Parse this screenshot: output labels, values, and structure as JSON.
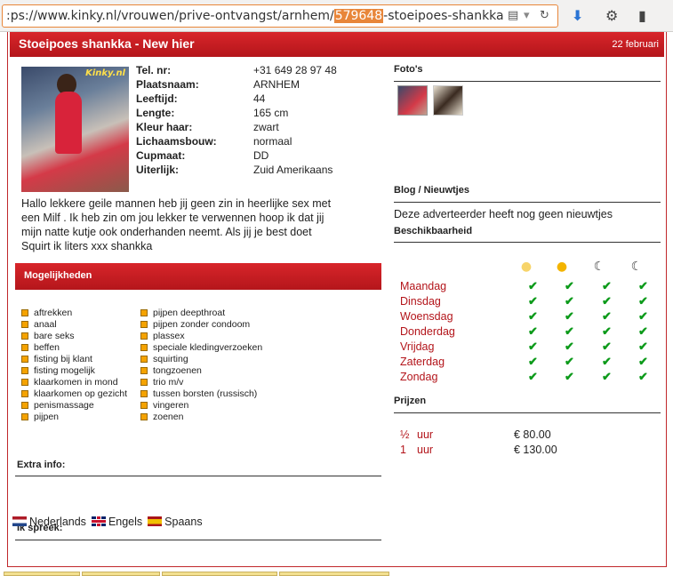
{
  "browser": {
    "url_prefix": ":ps://www.kinky.nl/vrouwen/prive-ontvangst/arnhem/",
    "url_highlight": "579648",
    "url_suffix": "-stoeipoes-shankka",
    "reader_icon": "reader-icon",
    "reload_icon": "reload-icon",
    "download_icon": "download-arrow-icon",
    "extension_icon": "extension-icon",
    "menu_icon": "menu-icon"
  },
  "header": {
    "title": "Stoeipoes shankka - New hier",
    "date": "22 februari"
  },
  "photo": {
    "logo": "Kinky.nl"
  },
  "info": [
    {
      "label": "Tel. nr:",
      "value": "+31 649 28 97 48"
    },
    {
      "label": "Plaatsnaam:",
      "value": "ARNHEM"
    },
    {
      "label": "Leeftijd:",
      "value": "44"
    },
    {
      "label": "Lengte:",
      "value": "165 cm"
    },
    {
      "label": "Kleur haar:",
      "value": "zwart"
    },
    {
      "label": "Lichaamsbouw:",
      "value": "normaal"
    },
    {
      "label": "Cupmaat:",
      "value": "DD"
    },
    {
      "label": "Uiterlijk:",
      "value": "Zuid Amerikaans"
    }
  ],
  "description": "Hallo lekkere geile mannen heb jij geen zin in heerlijke sex met een Milf . Ik heb zin om jou lekker te verwennen hoop ik dat jij mijn natte kutje ook onderhanden neemt. Als jij je best doet Squirt ik liters xxx shankka",
  "mogelijkheden": {
    "heading": "Mogelijkheden",
    "col1": [
      "aftrekken",
      "anaal",
      "bare seks",
      "beffen",
      "fisting bij klant",
      "fisting mogelijk",
      "klaarkomen in mond",
      "klaarkomen op gezicht",
      "penismassage",
      "pijpen"
    ],
    "col2": [
      "pijpen deepthroat",
      "pijpen zonder condoom",
      "plassex",
      "speciale kledingverzoeken",
      "squirting",
      "tongzoenen",
      "trio m/v",
      "tussen borsten (russisch)",
      "vingeren",
      "zoenen"
    ]
  },
  "extra_info": {
    "heading": "Extra info:"
  },
  "languages": {
    "heading": "Ik spreek:",
    "items": [
      {
        "label": "Nederlands",
        "flag": "flag-nl-icon"
      },
      {
        "label": "Engels",
        "flag": "flag-gb-icon"
      },
      {
        "label": "Spaans",
        "flag": "flag-es-icon"
      }
    ]
  },
  "photos": {
    "heading": "Foto's"
  },
  "blog": {
    "heading": "Blog / Nieuwtjes",
    "text": "Deze adverteerder heeft nog geen nieuwtjes"
  },
  "availability": {
    "heading": "Beschikbaarheid",
    "slots": [
      "sun-morning-icon",
      "sun-afternoon-icon",
      "moon-evening-icon",
      "moon-night-icon"
    ],
    "days": [
      {
        "day": "Maandag",
        "available": [
          true,
          true,
          true,
          true
        ]
      },
      {
        "day": "Dinsdag",
        "available": [
          true,
          true,
          true,
          true
        ]
      },
      {
        "day": "Woensdag",
        "available": [
          true,
          true,
          true,
          true
        ]
      },
      {
        "day": "Donderdag",
        "available": [
          true,
          true,
          true,
          true
        ]
      },
      {
        "day": "Vrijdag",
        "available": [
          true,
          true,
          true,
          true
        ]
      },
      {
        "day": "Zaterdag",
        "available": [
          true,
          true,
          true,
          true
        ]
      },
      {
        "day": "Zondag",
        "available": [
          true,
          true,
          true,
          true
        ]
      }
    ]
  },
  "prices": {
    "heading": "Prijzen",
    "rows": [
      {
        "qty": "½",
        "unit": "uur",
        "price": "€ 80.00"
      },
      {
        "qty": "1",
        "unit": "uur",
        "price": "€ 130.00"
      }
    ]
  },
  "colors": {
    "brand_red": "#c0282b",
    "day_red": "#b3141a",
    "check_green": "#0c9a1a",
    "bullet_orange": "#f5a300"
  }
}
